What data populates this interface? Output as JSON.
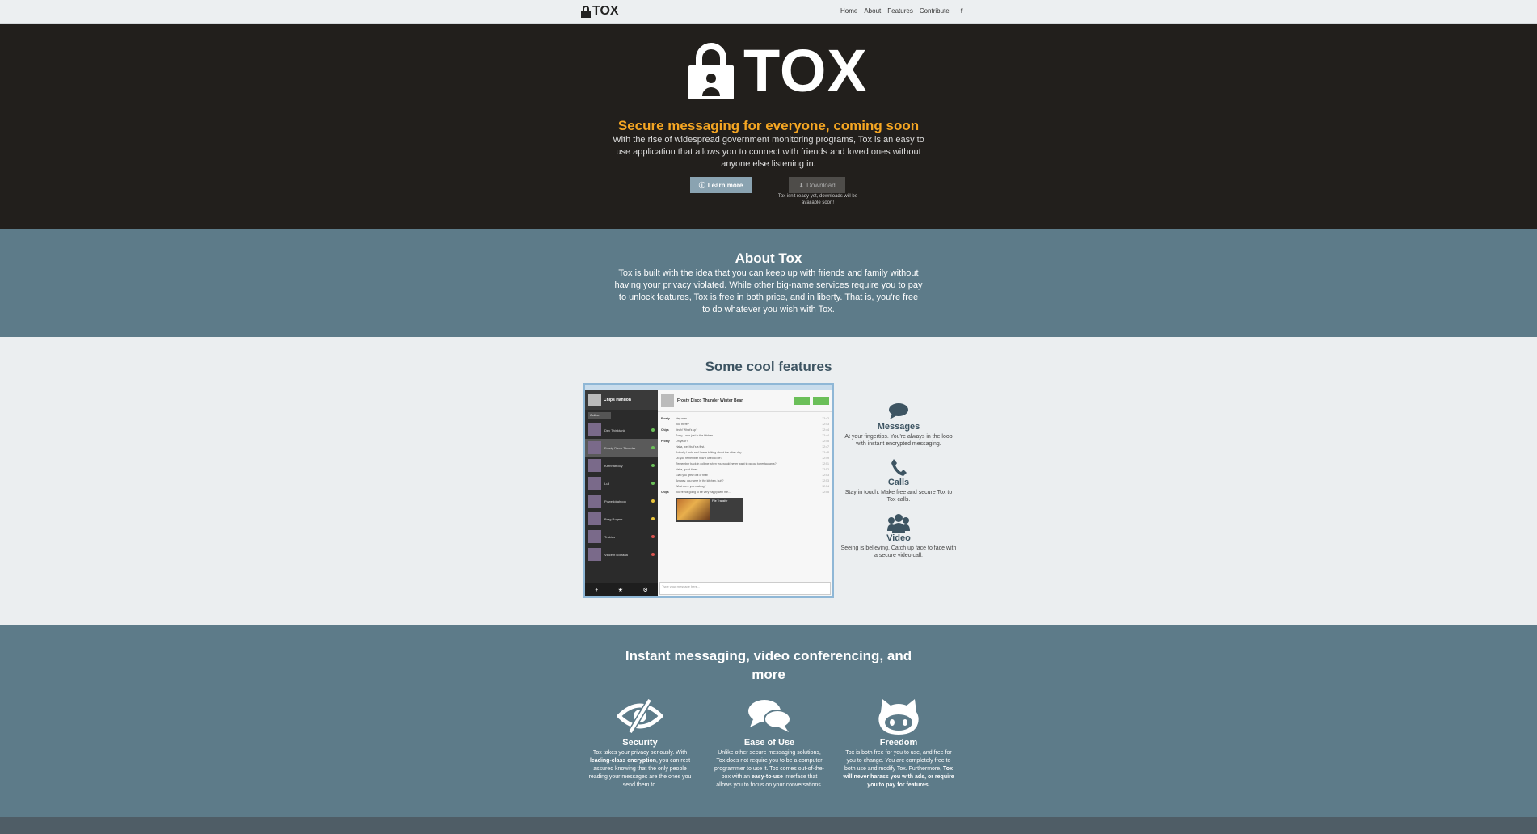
{
  "nav": {
    "logo_text": "TOX",
    "links": [
      "Home",
      "About",
      "Features",
      "Contribute"
    ],
    "facebook_label": "f"
  },
  "hero": {
    "logo_text": "TOX",
    "tagline": "Secure messaging for everyone, coming soon",
    "description": "With the rise of widespread government monitoring programs, Tox is an easy to use application that allows you to connect with friends and loved ones without anyone else listening in.",
    "learn_more_label": "Learn more",
    "download_label": "Download",
    "download_note": "Tox isn't ready yet, downloads will be available soon!"
  },
  "about": {
    "title": "About Tox",
    "text": "Tox is built with the idea that you can keep up with friends and family without having your privacy violated. While other big-name services require you to pay to unlock features, Tox is free in both price, and in liberty. That is, you're free to do whatever you wish with Tox."
  },
  "features": {
    "title": "Some cool features",
    "screenshot": {
      "self_name": "Chips Handon",
      "filter_label": "Online",
      "chat_title": "Frosty Disco Thunder Winter Bear",
      "input_placeholder": "Type your message here...",
      "file_label": "File Transfer",
      "contacts": [
        {
          "name": "Dev Thinktank",
          "status": "online"
        },
        {
          "name": "Frosty Disco Thunder...",
          "status": "online"
        },
        {
          "name": "Karrlhatrooly",
          "status": "online"
        },
        {
          "name": "Lull",
          "status": "online"
        },
        {
          "name": "Poweddrahoon",
          "status": "away"
        },
        {
          "name": "Brag Rogers",
          "status": "away"
        },
        {
          "name": "Trakius",
          "status": "busy"
        },
        {
          "name": "Vincent Dorrada",
          "status": "busy"
        }
      ],
      "messages": [
        {
          "who": "Frosty",
          "msg": "Hey man.",
          "ts": "12:42"
        },
        {
          "who": "",
          "msg": "You there?",
          "ts": "12:43"
        },
        {
          "who": "Chips",
          "msg": "Yeah! What's up?",
          "ts": "12:44"
        },
        {
          "who": "",
          "msg": "Sorry, I was just in the kitchen.",
          "ts": "12:44"
        },
        {
          "who": "Frosty",
          "msg": "Oh yeah?",
          "ts": "12:45"
        },
        {
          "who": "",
          "msg": "Haha, well that's a first.",
          "ts": "12:47"
        },
        {
          "who": "",
          "msg": "Actually Linda and I were talking about the other day.",
          "ts": "12:48"
        },
        {
          "who": "",
          "msg": "Do you remember how it used to be?",
          "ts": "12:49"
        },
        {
          "who": "",
          "msg": "Remember back in college when you would never want to go out to restaurants?",
          "ts": "12:51"
        },
        {
          "who": "",
          "msg": "Haha, good times.",
          "ts": "12:52"
        },
        {
          "who": "",
          "msg": "Glad you grew out of that!",
          "ts": "12:53"
        },
        {
          "who": "",
          "msg": "Anyway, you were in the kitchen, huh?",
          "ts": "12:53"
        },
        {
          "who": "",
          "msg": "What were you making?",
          "ts": "12:54"
        },
        {
          "who": "Chips",
          "msg": "You're not going to be very happy with me...",
          "ts": "12:55"
        }
      ]
    },
    "items": [
      {
        "title": "Messages",
        "text": "At your fingertips. You're always in the loop with instant encrypted messaging."
      },
      {
        "title": "Calls",
        "text": "Stay in touch. Make free and secure Tox to Tox calls."
      },
      {
        "title": "Video",
        "text": "Seeing is believing. Catch up face to face with a secure video call."
      }
    ]
  },
  "more": {
    "title": "Instant messaging, video conferencing, and more",
    "columns": [
      {
        "title": "Security",
        "pre": "Tox takes your privacy seriously. With ",
        "bold": "leading-class encryption",
        "post": ", you can rest assured knowing that the only people reading your messages are the ones you send them to."
      },
      {
        "title": "Ease of Use",
        "pre": "Unlike other secure messaging solutions, Tox does not require you to be a computer programmer to use it. Tox comes out-of-the-box with an ",
        "bold": "easy-to-use",
        "post": " interface that allows you to focus on your conversations."
      },
      {
        "title": "Freedom",
        "pre": "Tox is both free for you to use, and free for you to change. You are completely free to both use and modify Tox. Furthermore, ",
        "bold": "Tox will never harass you with ads, or require you to pay for features.",
        "post": ""
      }
    ]
  },
  "colors": {
    "accent_orange": "#f5a623",
    "section_blue": "#5d7b89",
    "hero_dark": "#221f1c",
    "online_green": "#6bbf59",
    "away_yellow": "#e8c33b",
    "busy_red": "#d9534f"
  }
}
